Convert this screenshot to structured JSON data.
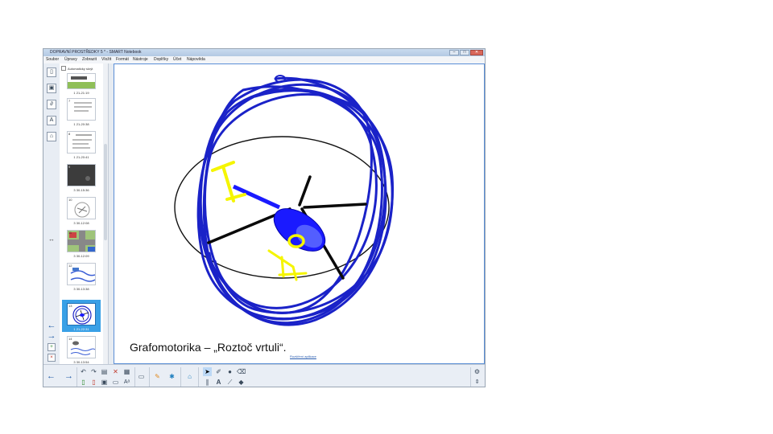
{
  "window": {
    "title": "DOPRAVNÍ PROSTŘEDKY 5 * - SMART Notebook",
    "min_label": "–",
    "max_label": "□",
    "close_label": "✕"
  },
  "menu": [
    "Soubor",
    "Úpravy",
    "Zobrazit",
    "Vložit",
    "Formát",
    "Nástroje",
    "Doplňky",
    "Účet",
    "Nápověda"
  ],
  "sorter": {
    "autohide_label": "Automaticky skrýt",
    "pages": [
      {
        "num": "",
        "label": "1 21-21:19"
      },
      {
        "num": "7",
        "label": "1 21-20:38"
      },
      {
        "num": "8",
        "label": "1 21-20:41"
      },
      {
        "num": "9",
        "label": "3 30-15:36"
      },
      {
        "num": "10",
        "label": "3 30-12:08"
      },
      {
        "num": "11",
        "label": "3 30-12:09"
      },
      {
        "num": "12",
        "label": "3 30-13:38"
      },
      {
        "num": "13",
        "label": "1 21-22:31"
      },
      {
        "num": "14",
        "label": "3 30-13:54"
      }
    ],
    "selected_index": 7
  },
  "canvas": {
    "caption": "Grafomotorika – „Roztoč vrtuli“.",
    "small_caption": "Rozšíření aplikace"
  },
  "icons": {
    "back": "arrow-left-icon",
    "forward": "arrow-right-icon",
    "settings": "gear-icon"
  },
  "colors": {
    "scribble": "#1a22c8",
    "rotor_circle": "#000000",
    "helicopter_body": "#1a1aff",
    "skids": "#ffff00",
    "selection": "#39a0e6"
  }
}
